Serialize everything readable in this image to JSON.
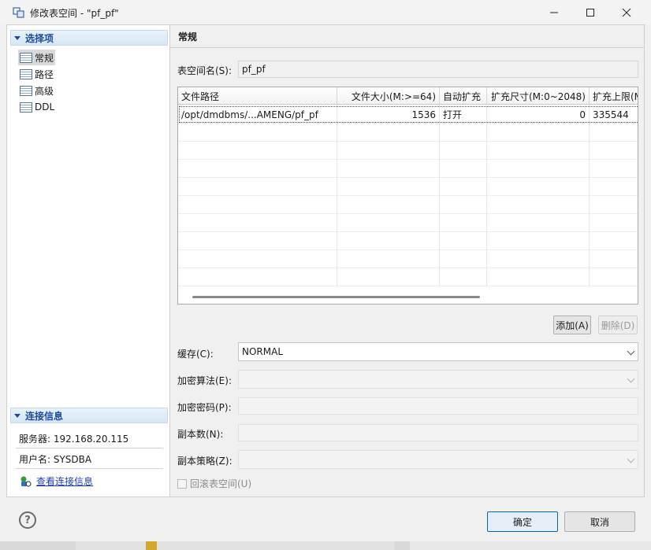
{
  "window": {
    "title": "修改表空间 - \"pf_pf\""
  },
  "nav": {
    "header": "选择项",
    "items": [
      {
        "label": "常规",
        "selected": true
      },
      {
        "label": "路径",
        "selected": false
      },
      {
        "label": "高级",
        "selected": false
      },
      {
        "label": "DDL",
        "selected": false
      }
    ]
  },
  "connection": {
    "header": "连接信息",
    "server": "服务器: 192.168.20.115",
    "user": "用户名: SYSDBA",
    "link": "查看连接信息"
  },
  "general": {
    "title": "常规",
    "tablespace_label": "表空间名(S):",
    "tablespace_value": "pf_pf",
    "columns": [
      "文件路径",
      "文件大小(M:>=64)",
      "自动扩充",
      "扩充尺寸(M:0~2048)",
      "扩充上限(M"
    ],
    "rows": [
      [
        "/opt/dmdbms/...AMENG/pf_pf",
        "1536",
        "打开",
        "0",
        "335544"
      ]
    ],
    "add_button": "添加(A)",
    "delete_button": "删除(D)",
    "cache_label": "缓存(C):",
    "cache_value": "NORMAL",
    "encrypt_algo_label": "加密算法(E):",
    "encrypt_pwd_label": "加密密码(P):",
    "copies_label": "副本数(N):",
    "copy_policy_label": "副本策略(Z):",
    "rollback_label": "回滚表空间(U)"
  },
  "footer": {
    "help": "?",
    "ok": "确定",
    "cancel": "取消"
  }
}
